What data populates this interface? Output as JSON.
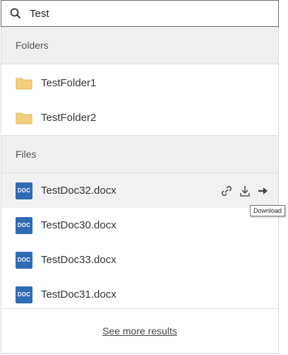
{
  "search": {
    "value": "Test",
    "icon": "search-icon"
  },
  "folders": {
    "header": "Folders",
    "items": [
      {
        "label": "TestFolder1",
        "icon": "folder-icon"
      },
      {
        "label": "TestFolder2",
        "icon": "folder-icon"
      }
    ]
  },
  "files": {
    "header": "Files",
    "items": [
      {
        "label": "TestDoc32.docx",
        "icon": "doc-icon",
        "badge": "DOC"
      },
      {
        "label": "TestDoc30.docx",
        "icon": "doc-icon",
        "badge": "DOC"
      },
      {
        "label": "TestDoc33.docx",
        "icon": "doc-icon",
        "badge": "DOC"
      },
      {
        "label": "TestDoc31.docx",
        "icon": "doc-icon",
        "badge": "DOC"
      }
    ]
  },
  "actions": {
    "link_icon": "link-icon",
    "download_icon": "download-icon",
    "open_icon": "arrow-right-icon"
  },
  "tooltip": {
    "text": "Download"
  },
  "footer": {
    "see_more": "See more results"
  },
  "colors": {
    "doc_blue": "#2f6ab4",
    "folder": "#f2cf7a",
    "header_bg": "#efefef"
  }
}
